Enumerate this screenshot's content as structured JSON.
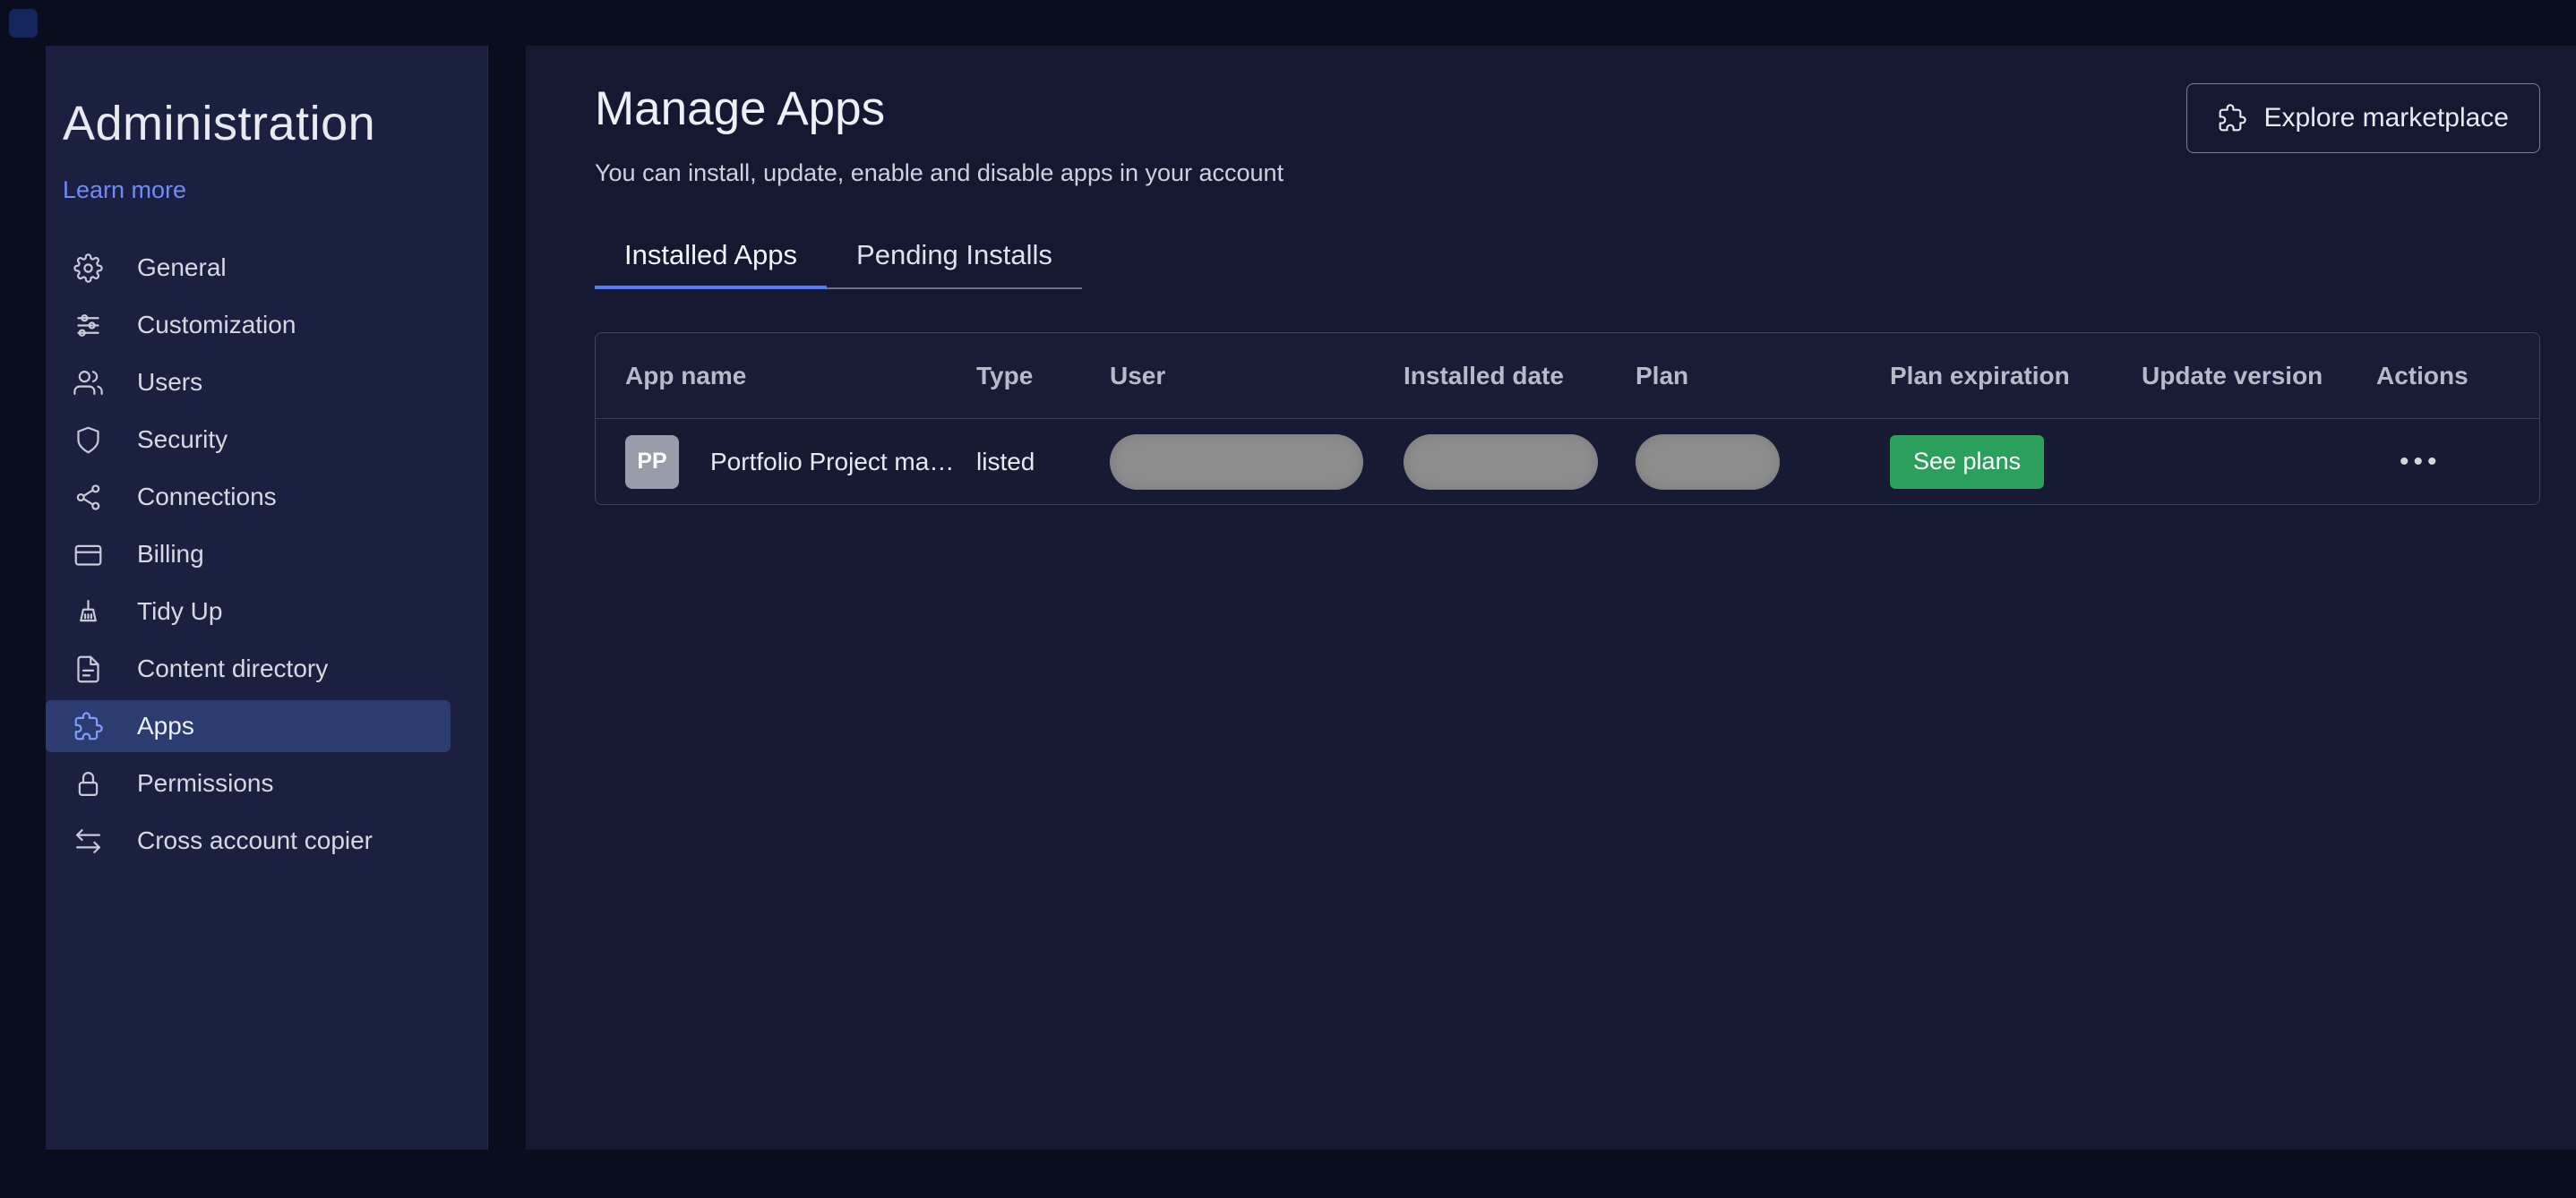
{
  "sidebar": {
    "title": "Administration",
    "learn_more_label": "Learn more",
    "items": [
      {
        "label": "General",
        "icon": "gear-icon",
        "selected": false
      },
      {
        "label": "Customization",
        "icon": "sliders-icon",
        "selected": false
      },
      {
        "label": "Users",
        "icon": "users-icon",
        "selected": false
      },
      {
        "label": "Security",
        "icon": "shield-icon",
        "selected": false
      },
      {
        "label": "Connections",
        "icon": "nodes-icon",
        "selected": false
      },
      {
        "label": "Billing",
        "icon": "credit-card-icon",
        "selected": false
      },
      {
        "label": "Tidy Up",
        "icon": "broom-icon",
        "selected": false
      },
      {
        "label": "Content directory",
        "icon": "document-icon",
        "selected": false
      },
      {
        "label": "Apps",
        "icon": "puzzle-icon",
        "selected": true
      },
      {
        "label": "Permissions",
        "icon": "lock-icon",
        "selected": false
      },
      {
        "label": "Cross account copier",
        "icon": "transfer-arrows-icon",
        "selected": false
      }
    ]
  },
  "main": {
    "title": "Manage Apps",
    "subtitle": "You can install, update, enable and disable apps in your account",
    "explore_marketplace_label": "Explore marketplace",
    "tabs": [
      {
        "label": "Installed Apps",
        "active": true
      },
      {
        "label": "Pending Installs",
        "active": false
      }
    ],
    "table": {
      "columns": [
        "App name",
        "Type",
        "User",
        "Installed date",
        "Plan",
        "Plan expiration",
        "Update version",
        "Actions"
      ],
      "row": {
        "avatar_initials": "PP",
        "app_name": "Portfolio Project ma…",
        "type": "listed",
        "redacted_fields": [
          "User",
          "Installed date",
          "Plan"
        ],
        "plan_expiration_action": "See plans",
        "update_version": "",
        "actions_label": "•••"
      }
    }
  },
  "colors": {
    "accent_blue": "#567cf5",
    "link_blue": "#6d8cf8",
    "selected_item_bg": "#2d3b70",
    "green_button": "#2aa05c",
    "redacted_gray": "#8e8e8e",
    "sidebar_bg": "#1c2040",
    "main_bg": "#151831",
    "frame_bg": "#0a0d1e"
  }
}
